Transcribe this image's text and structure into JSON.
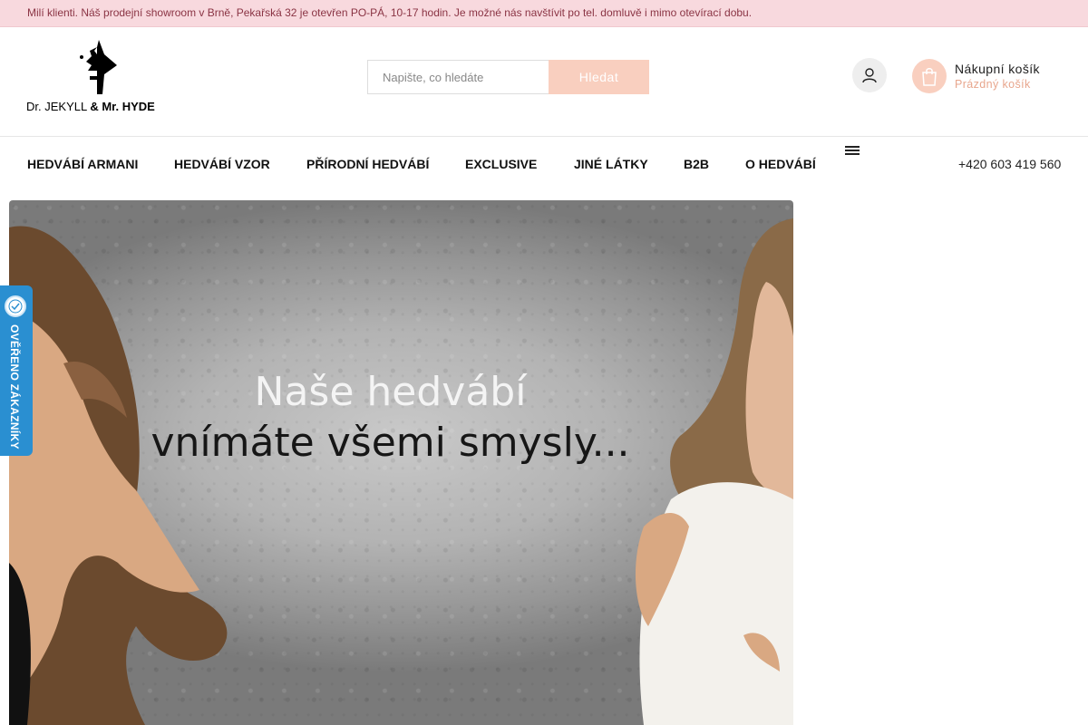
{
  "announcement": "Milí klienti. Náš prodejní showroom v Brně, Pekařská 32 je otevřen PO-PÁ, 10-17 hodin. Je možné nás navštívit po tel. domluvě i mimo otevírací dobu.",
  "logo": {
    "icon": "jekyll-hyde-face-logo",
    "text_part1": "Dr. JEKYLL",
    "text_part2": "& Mr. HYDE"
  },
  "search": {
    "placeholder": "Napište, co hledáte",
    "value": "",
    "button_label": "Hledat"
  },
  "user": {
    "icon": "user-icon"
  },
  "cart": {
    "icon": "shopping-bag-icon",
    "title": "Nákupní košík",
    "status": "Prázdný košík"
  },
  "nav": {
    "items": [
      {
        "label": "HEDVÁBÍ ARMANI"
      },
      {
        "label": "HEDVÁBÍ VZOR"
      },
      {
        "label": "PŘÍRODNÍ HEDVÁBÍ"
      },
      {
        "label": "EXCLUSIVE"
      },
      {
        "label": "JINÉ LÁTKY"
      },
      {
        "label": "B2B"
      },
      {
        "label": "O HEDVÁBÍ"
      }
    ],
    "more_icon": "hamburger-icon",
    "icon1": "",
    "icon2": "",
    "phone": "+420 603 419 560"
  },
  "banner": {
    "line1": "Naše hedvábí",
    "line2": "vnímáte všemi smysly..."
  },
  "verified_badge": {
    "text": "OVĚŘENO ZÁKAZNÍKY",
    "icon": "heureka-badge-icon"
  },
  "colors": {
    "announcement_bg": "#f8d9de",
    "accent": "#f9cfbf",
    "accent_text": "#e8a68d",
    "badge_blue": "#2a8fd1"
  }
}
